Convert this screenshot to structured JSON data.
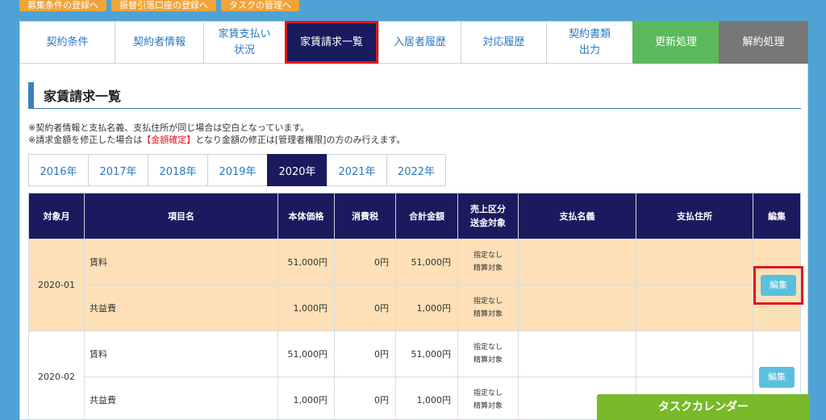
{
  "top_buttons": [
    "募集条件の登録へ",
    "振替引落口座の登録へ",
    "タスクの管理へ"
  ],
  "tabs": [
    {
      "label": "契約条件"
    },
    {
      "label": "契約者情報"
    },
    {
      "label": "家賃支払い\n状況"
    },
    {
      "label": "家賃請求一覧"
    },
    {
      "label": "入居者履歴"
    },
    {
      "label": "対応履歴"
    },
    {
      "label": "契約書類\n出力"
    },
    {
      "label": "更新処理"
    },
    {
      "label": "解約処理"
    }
  ],
  "section_title": "家賃請求一覧",
  "notes": {
    "line1": "※契約者情報と支払名義、支払住所が同じ場合は空白となっています。",
    "line2_pre": "※請求金額を修正した場合は",
    "line2_red": "【金額確定】",
    "line2_post": "となり金額の修正は[管理者権限]の方のみ行えます。"
  },
  "years": [
    "2016年",
    "2017年",
    "2018年",
    "2019年",
    "2020年",
    "2021年",
    "2022年"
  ],
  "active_year": "2020年",
  "table": {
    "headers": {
      "month": "対象月",
      "item": "項目名",
      "base": "本体価格",
      "tax": "消費税",
      "total": "合計金額",
      "sales_line1": "売上区分",
      "sales_line2": "送金対象",
      "payer_name": "支払名義",
      "payer_address": "支払住所",
      "edit": "編集"
    },
    "groups": [
      {
        "month": "2020-01",
        "edit_label": "編集",
        "rows": [
          {
            "item": "賃料",
            "base": "51,000円",
            "tax": "0円",
            "total": "51,000円",
            "sales1": "指定なし",
            "sales2": "精算対象"
          },
          {
            "item": "共益費",
            "base": "1,000円",
            "tax": "0円",
            "total": "1,000円",
            "sales1": "指定なし",
            "sales2": "精算対象"
          }
        ]
      },
      {
        "month": "2020-02",
        "edit_label": "編集",
        "rows": [
          {
            "item": "賃料",
            "base": "51,000円",
            "tax": "0円",
            "total": "51,000円",
            "sales1": "指定なし",
            "sales2": "精算対象"
          },
          {
            "item": "共益費",
            "base": "1,000円",
            "tax": "0円",
            "total": "1,000円",
            "sales1": "指定なし",
            "sales2": "精算対象"
          }
        ]
      }
    ]
  },
  "task_calendar": "タスクカレンダー",
  "colors": {
    "navy": "#1a1a5e",
    "highlight_red": "#e3151b",
    "row_highlight": "#fde0b7",
    "green": "#5cb85c",
    "edit_button": "#5bc0de"
  }
}
